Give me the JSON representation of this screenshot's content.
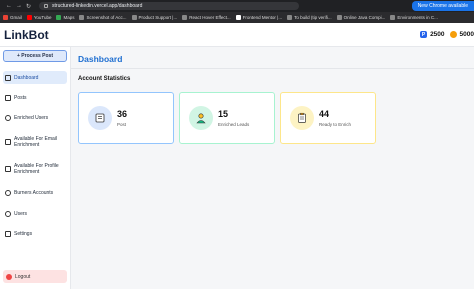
{
  "browser": {
    "url": "structured-linkedin.vercel.app/dashboard",
    "new_chrome_label": "New Chrome available",
    "bookmarks": [
      "Gmail",
      "YouTube",
      "Maps",
      "Screenshot of Acc...",
      "Product Support |...",
      "React Hover Effect...",
      "Frontend Mentor |...",
      "To build (tip verifi...",
      "Online Java Compi...",
      "Environments in C..."
    ]
  },
  "app": {
    "brand": "LinkBot",
    "credits": [
      {
        "value": "2500",
        "icon": "coin-icon",
        "color": "#2563eb"
      },
      {
        "value": "5000",
        "icon": "gold-coin-icon",
        "color": "#f59e0b"
      }
    ]
  },
  "sidebar": {
    "process_button": "+ Process Post",
    "items": [
      {
        "label": "Dashboard",
        "icon": "dashboard-icon",
        "active": true
      },
      {
        "label": "Posts",
        "icon": "posts-icon"
      },
      {
        "label": "Enriched Users",
        "icon": "enriched-users-icon"
      },
      {
        "label": "Available For Email Enrichment",
        "icon": "email-icon"
      },
      {
        "label": "Available For Profile Enrichment",
        "icon": "profile-icon"
      },
      {
        "label": "Burners Accounts",
        "icon": "burners-icon"
      },
      {
        "label": "Users",
        "icon": "users-icon"
      },
      {
        "label": "Settings",
        "icon": "settings-icon"
      }
    ],
    "logout": "Logout"
  },
  "main": {
    "title": "Dashboard",
    "section_title": "Account Statistics",
    "stats": [
      {
        "value": "36",
        "label": "Post",
        "icon": "post-icon",
        "color": "#93c5fd"
      },
      {
        "value": "15",
        "label": "Enriched Leads",
        "icon": "enriched-leads-icon",
        "color": "#a7f3d0"
      },
      {
        "value": "44",
        "label": "Ready to Enrich",
        "icon": "ready-icon",
        "color": "#fde68a"
      }
    ]
  }
}
